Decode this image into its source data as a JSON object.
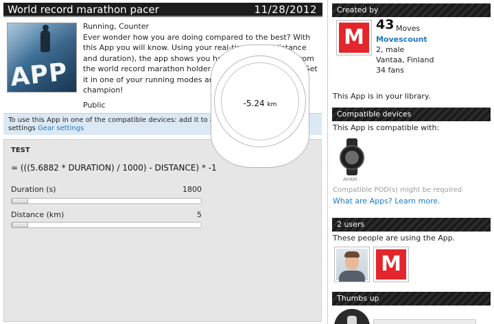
{
  "app": {
    "title": "World record marathon pacer",
    "date": "11/28/2012",
    "thumbnail_label": "APP",
    "categories": "Running, Counter",
    "description": "Ever wonder how you are doing compared to the best? With this App you will know. Using your real-time pace (distance and duration), the app shows you how far away you are from the world record marathon holder while you try your best. Set it in one of your running modes and race against the champion!",
    "visibility": "Public"
  },
  "info": {
    "text": "To use this App in one of the compatible devices: add it to a custom mode in Gear settings ",
    "link": "Gear settings"
  },
  "simulator": {
    "heading": "TEST",
    "formula": "= (((5.6882 * DURATION) / 1000) - DISTANCE) * -1",
    "sliders": [
      {
        "label": "Duration (s)",
        "value": "1800"
      },
      {
        "label": "Distance (km)",
        "value": "5"
      }
    ],
    "result": "-5.24",
    "result_unit": "km"
  },
  "sidebar": {
    "created_by": {
      "heading": "Created by",
      "logo_letter": "M",
      "moves_count": "43",
      "moves_label": "Moves",
      "username": "Movescount",
      "age_gender": "2, male",
      "location": "Vantaa, Finland",
      "fans": "34 fans",
      "library_note": "This App is in your library."
    },
    "compatible": {
      "heading": "Compatible devices",
      "intro": "This App is compatible with:",
      "device_name": "Ambit",
      "pod_note": "Compatible POD(s) might be required",
      "link": "What are Apps? Learn more."
    },
    "users": {
      "heading": "2 users",
      "intro": "These people are using the App.",
      "logo_letter": "M"
    },
    "thumbs": {
      "heading": "Thumbs up"
    }
  },
  "colors": {
    "accent_link": "#1a78c9",
    "brand_red": "#e4262c",
    "header_dark": "#1c1c1c",
    "info_bg": "#dce9f5",
    "sim_bg": "#e6e6e6"
  }
}
